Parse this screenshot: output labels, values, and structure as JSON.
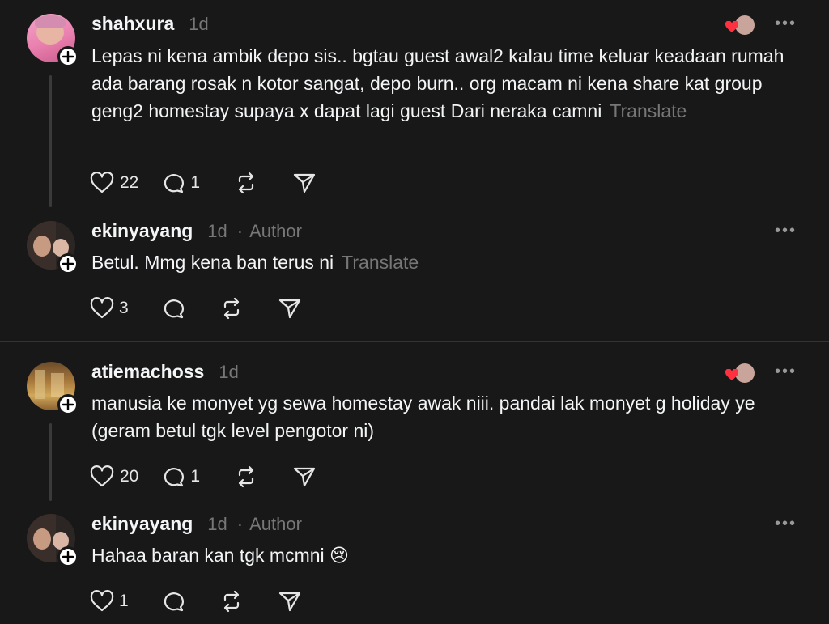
{
  "comments": [
    {
      "username": "shahxura",
      "time": "1d",
      "author_tag": "",
      "text": "Lepas ni kena ambik depo sis.. bgtau guest awal2 kalau time keluar keadaan rumah ada barang rosak n kotor sangat, depo burn.. org macam ni kena share kat group geng2 homestay supaya x dapat lagi guest Dari neraka camni",
      "translate": "Translate",
      "likes": "22",
      "replies": "1",
      "liked_by_author": true
    },
    {
      "username": "ekinyayang",
      "time": "1d",
      "author_tag": "Author",
      "text": "Betul. Mmg kena ban terus ni",
      "translate": "Translate",
      "likes": "3",
      "replies": ""
    },
    {
      "username": "atiemachoss",
      "time": "1d",
      "author_tag": "",
      "text": "manusia ke monyet yg sewa homestay awak niii. pandai lak monyet g holiday ye (geram betul tgk level pengotor ni)",
      "translate": "",
      "likes": "20",
      "replies": "1",
      "liked_by_author": true
    },
    {
      "username": "ekinyayang",
      "time": "1d",
      "author_tag": "Author",
      "text": "Hahaa baran kan tgk mcmni 😢",
      "translate": "",
      "likes": "1",
      "replies": ""
    }
  ],
  "separator": "·",
  "more_label": "•••",
  "icons": [
    "heart-icon",
    "reply-icon",
    "repost-icon",
    "share-icon",
    "more-icon",
    "follow-plus-icon"
  ]
}
